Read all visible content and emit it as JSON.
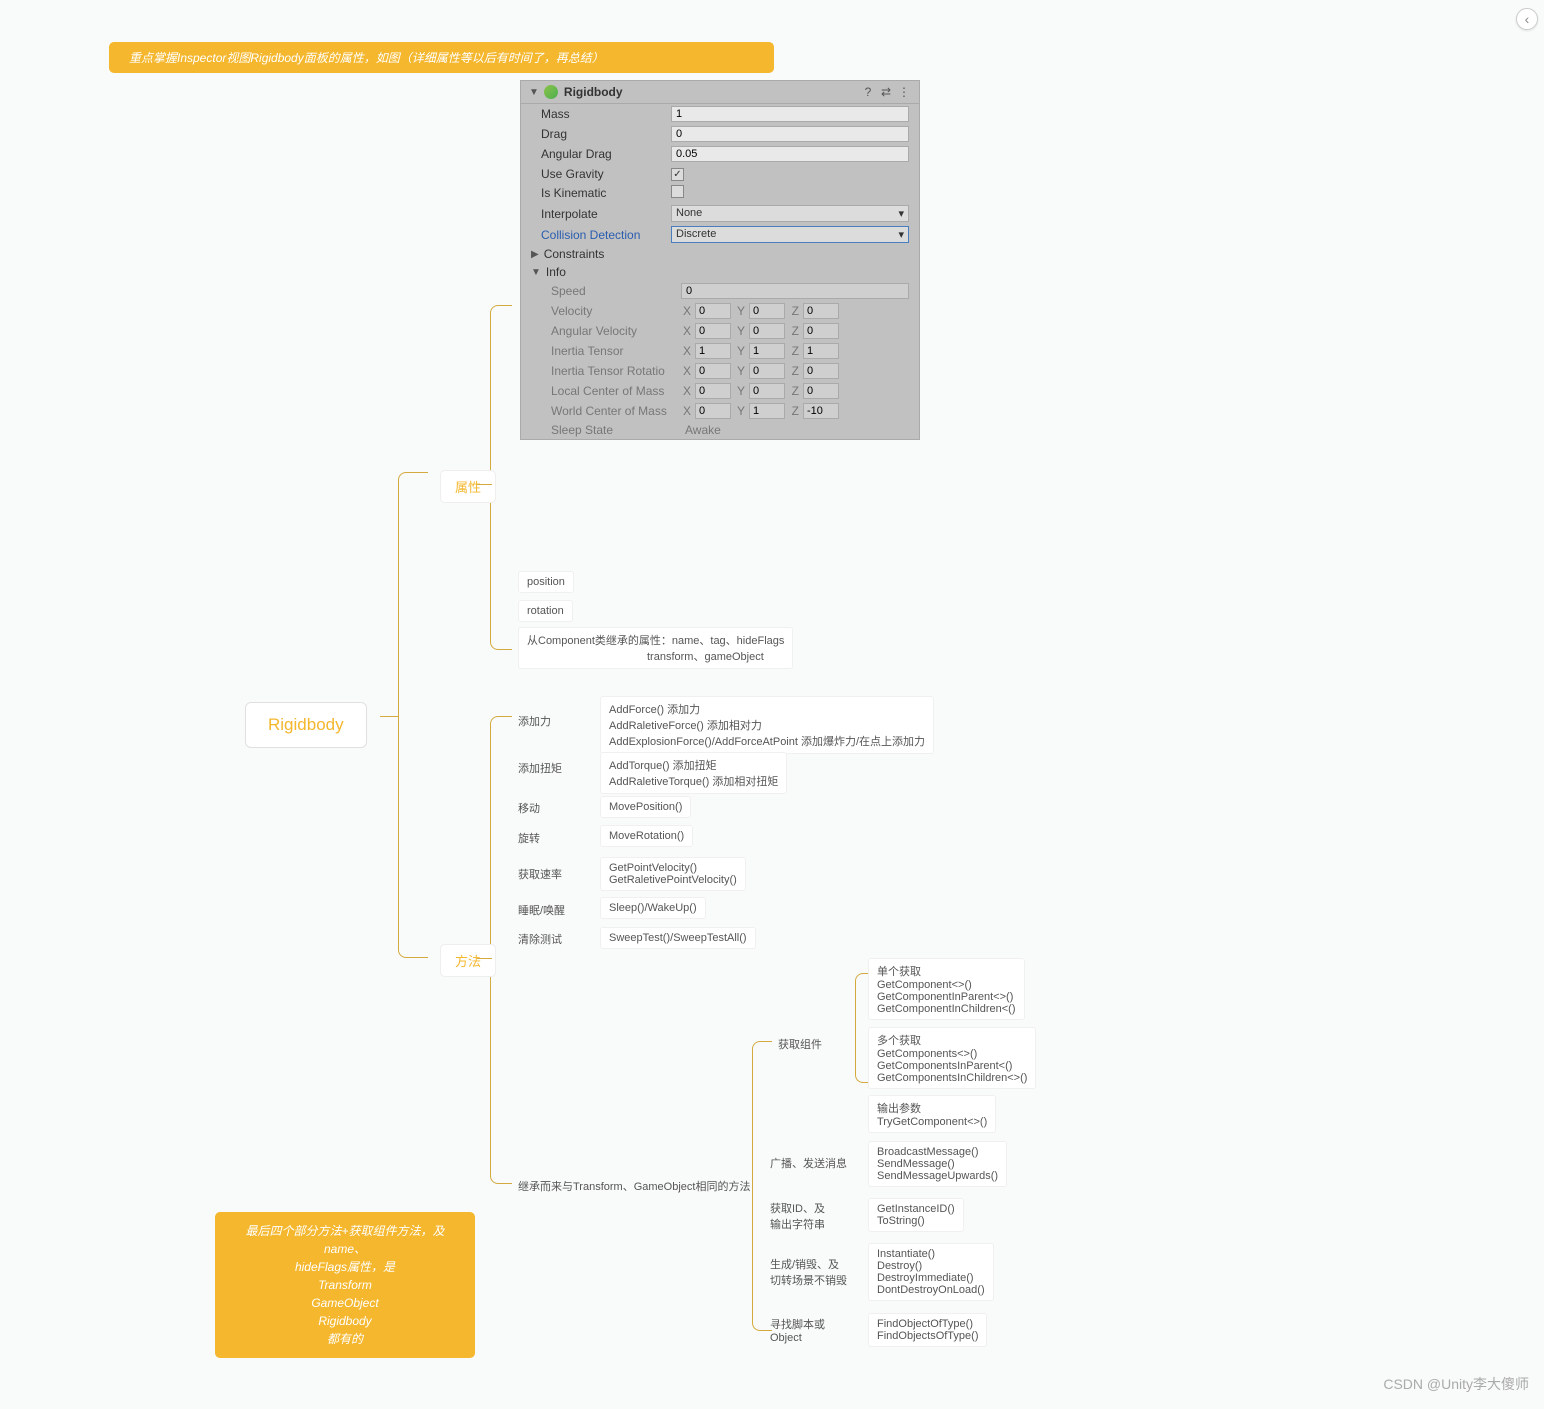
{
  "banner": "重点掌握Inspector视图Rigidbody面板的属性，如图（详细属性等以后有时间了，再总结）",
  "root": "Rigidbody",
  "note": {
    "l1": "最后四个部分方法+获取组件方法，及name、",
    "l2": "hideFlags属性，是",
    "l3": "Transform",
    "l4": "GameObject",
    "l5": "Rigidbody",
    "l6": "都有的"
  },
  "branch": {
    "props": "属性",
    "methods": "方法"
  },
  "inspector": {
    "title": "Rigidbody",
    "fields": {
      "mass": {
        "k": "Mass",
        "v": "1"
      },
      "drag": {
        "k": "Drag",
        "v": "0"
      },
      "angdrag": {
        "k": "Angular Drag",
        "v": "0.05"
      },
      "grav": {
        "k": "Use Gravity",
        "checked": true
      },
      "kin": {
        "k": "Is Kinematic",
        "checked": false
      },
      "interp": {
        "k": "Interpolate",
        "v": "None"
      },
      "coll": {
        "k": "Collision Detection",
        "v": "Discrete"
      },
      "constr": "Constraints",
      "info": "Info",
      "speed": {
        "k": "Speed",
        "v": "0"
      },
      "vel": {
        "k": "Velocity",
        "x": "0",
        "y": "0",
        "z": "0"
      },
      "angvel": {
        "k": "Angular Velocity",
        "x": "0",
        "y": "0",
        "z": "0"
      },
      "inertia": {
        "k": "Inertia Tensor",
        "x": "1",
        "y": "1",
        "z": "1"
      },
      "inertiarot": {
        "k": "Inertia Tensor Rotatio",
        "x": "0",
        "y": "0",
        "z": "0"
      },
      "lcenter": {
        "k": "Local Center of Mass",
        "x": "0",
        "y": "0",
        "z": "0"
      },
      "wcenter": {
        "k": "World Center of Mass",
        "x": "0",
        "y": "1",
        "z": "-10"
      },
      "sleep": {
        "k": "Sleep State",
        "v": "Awake"
      }
    }
  },
  "leafs": {
    "pos": "position",
    "rot": "rotation",
    "inher1": "从Component类继承的属性：name、tag、hideFlags",
    "inher2": "transform、gameObject",
    "addforce_l": "添加力",
    "addforce": "AddForce() 添加力\nAddRaletiveForce() 添加相对力\nAddExplosionForce()/AddForceAtPoint 添加爆炸力/在点上添加力",
    "addtorque_l": "添加扭矩",
    "addtorque": "AddTorque() 添加扭矩\nAddRaletiveTorque() 添加相对扭矩",
    "move_l": "移动",
    "move": "MovePosition()",
    "rot_l": "旋转",
    "rotm": "MoveRotation()",
    "getvel_l": "获取速率",
    "getvel": "GetPointVelocity()\nGetRaletivePointVelocity()",
    "sleep_l": "睡眠/唤醒",
    "sleep": "Sleep()/WakeUp()",
    "sweep_l": "清除测试",
    "sweep": "SweepTest()/SweepTestAll()",
    "inherit": "继承而来与Transform、GameObject相同的方法",
    "getcomp_l": "获取组件",
    "single": "单个获取\nGetComponent<>()\nGetComponentInParent<>()\nGetComponentInChildren<()",
    "multi": "多个获取\nGetComponents<>()\nGetComponentsInParent<()\nGetComponentsInChildren<>()",
    "output": "输出参数\nTryGetComponent<>()",
    "broadcast_l": "广播、发送消息",
    "broadcast": "BroadcastMessage()\nSendMessage()\nSendMessageUpwards()",
    "getid_l": "获取ID、及\n输出字符串",
    "getid": "GetInstanceID()\nToString()",
    "inst_l": "生成/销毁、及\n切转场景不销毁",
    "inst": "Instantiate()\nDestroy()\nDestroyImmediate()\nDontDestroyOnLoad()",
    "find_l": "寻找脚本或\nObject",
    "find": "FindObjectOfType()\nFindObjectsOfType()"
  },
  "watermark": "CSDN @Unity李大傻师",
  "xyz": {
    "x": "X",
    "y": "Y",
    "z": "Z"
  }
}
